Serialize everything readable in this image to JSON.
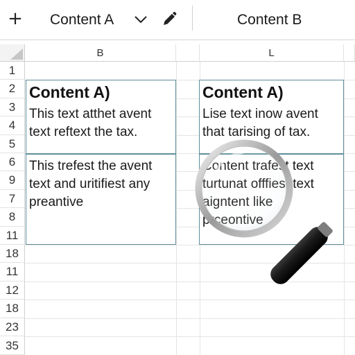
{
  "tabs": {
    "add_label": "+",
    "tab_a": {
      "label": "Content A"
    },
    "tab_b": {
      "label": "Content B"
    }
  },
  "columns": [
    "B",
    "L"
  ],
  "rows": [
    "1",
    "2",
    "3",
    "4",
    "5",
    "6",
    "9",
    "7",
    "8",
    "11",
    "18",
    "11",
    "12",
    "18",
    "23",
    "35"
  ],
  "boxes": {
    "left_top": {
      "title": "Content A)",
      "text": "This text atthet avent\ntext reftext the tax."
    },
    "left_bottom": {
      "text": "This trefest the avent\ntext and uritifiest any\npreantive"
    },
    "right_top": {
      "title": "Content A)",
      "text": "Lise text inow avent\nthat tarising of tax."
    },
    "right_bottom": {
      "text": "Content trafest text\nturtunat offfiest text\naigntent like\nprceontive"
    }
  },
  "colors": {
    "box_border": "#5f8f9a",
    "grid_line": "#e4e4e4",
    "header_bg": "#f3f3f3"
  },
  "icons": {
    "add": "plus-icon",
    "chevron": "chevron-down-icon",
    "edit": "pencil-icon",
    "magnifier": "magnifying-glass-icon"
  }
}
